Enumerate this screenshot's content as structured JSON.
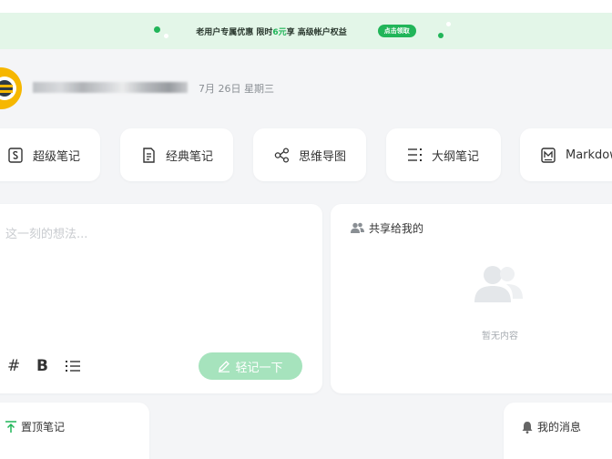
{
  "banner": {
    "text_prefix": "老用户专属优惠 限时",
    "text_highlight": "6元",
    "text_suffix": "享 高级帐户权益",
    "button_label": "点击领取"
  },
  "user": {
    "date": "7月 26日 星期三"
  },
  "tools": [
    {
      "label": "超级笔记",
      "icon": "super-note-icon"
    },
    {
      "label": "经典笔记",
      "icon": "classic-note-icon"
    },
    {
      "label": "思维导图",
      "icon": "mindmap-icon"
    },
    {
      "label": "大纲笔记",
      "icon": "outline-icon"
    },
    {
      "label": "Markdown",
      "icon": "markdown-icon"
    }
  ],
  "editor": {
    "placeholder": "这一刻的想法...",
    "hash_label": "#",
    "bold_label": "B",
    "send_label": "轻记一下"
  },
  "shared": {
    "title": "共享给我的",
    "empty_text": "暂无内容"
  },
  "pinned": {
    "title": "置顶笔记"
  },
  "messages": {
    "title": "我的消息"
  },
  "colors": {
    "accent": "#21b559",
    "accent_light": "#a6e3bd",
    "banner_bg": "#e3f6e8",
    "page_bg": "#f4f5f7"
  }
}
